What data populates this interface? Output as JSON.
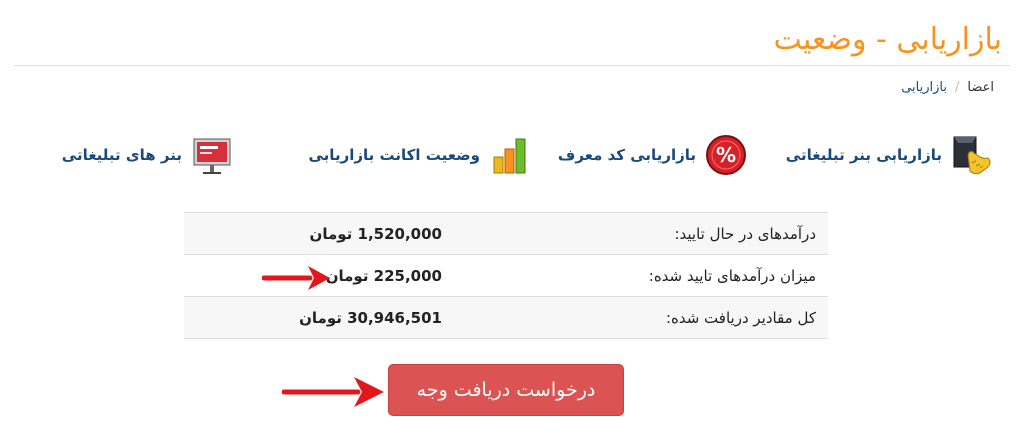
{
  "header": {
    "title": "بازاریابی - وضعیت"
  },
  "breadcrumb": {
    "items": [
      "اعضا",
      "بازاریابی"
    ],
    "separator": "/"
  },
  "nav": {
    "items": [
      {
        "label": "بازاریابی بنر تبلیغاتی",
        "icon": "pointing-hand-icon"
      },
      {
        "label": "بازاریابی کد معرف",
        "icon": "percent-icon"
      },
      {
        "label": "وضعیت اکانت بازاریابی",
        "icon": "bar-chart-icon"
      },
      {
        "label": "بنر های تبلیغاتی",
        "icon": "billboard-icon"
      }
    ]
  },
  "stats": [
    {
      "key": "درآمدهای در حال تایید:",
      "value": "1,520,000 تومان"
    },
    {
      "key": "میزان درآمدهای تایید شده:",
      "value": "225,000 تومان"
    },
    {
      "key": "کل مقادیر دریافت شده:",
      "value": "30,946,501 تومان"
    }
  ],
  "actions": {
    "withdraw_label": "درخواست دریافت وجه"
  },
  "colors": {
    "accent": "#f7931e",
    "link": "#1a4a7c",
    "button": "#db5352",
    "arrow": "#e3171b"
  }
}
